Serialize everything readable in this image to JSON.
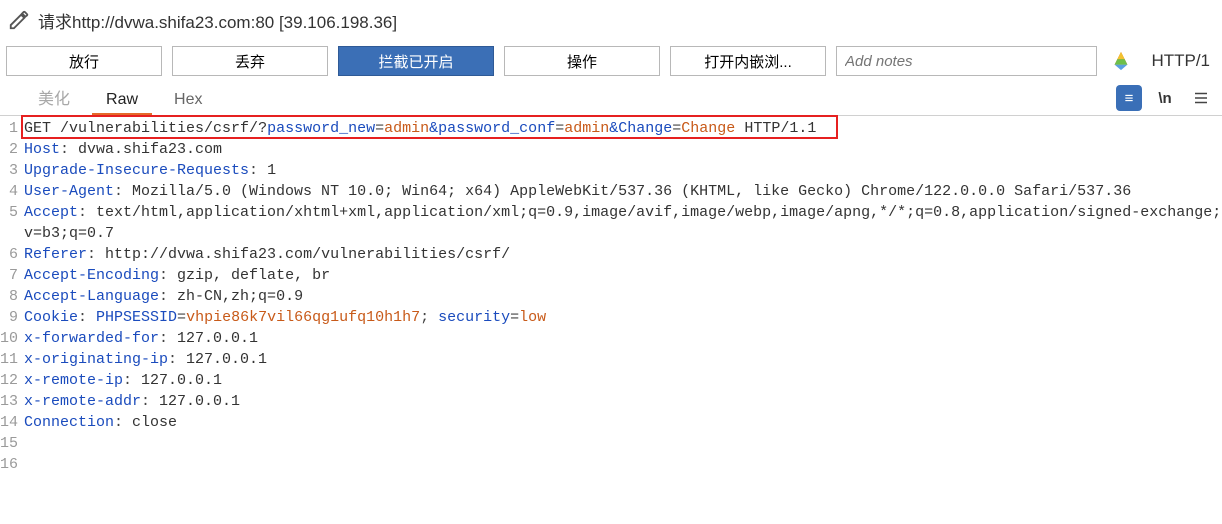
{
  "title": "请求http://dvwa.shifa23.com:80  [39.106.198.36]",
  "toolbar": {
    "forward": "放行",
    "drop": "丢弃",
    "intercept": "拦截已开启",
    "action": "操作",
    "open_browser": "打开内嵌浏...",
    "notes_placeholder": "Add notes",
    "protocol": "HTTP/1"
  },
  "tabs": {
    "beautify": "美化",
    "raw": "Raw",
    "hex": "Hex"
  },
  "http": {
    "method": "GET",
    "path": "/vulnerabilities/csrf/",
    "qmark": "?",
    "p1k": "password_new",
    "p1v": "admin",
    "amp": "&",
    "p2k": "password_conf",
    "p2v": "admin",
    "p3k": "Change",
    "p3v": "Change",
    "version": "HTTP/1.1",
    "host_k": "Host",
    "host_v": "dvwa.shifa23.com",
    "uir_k": "Upgrade-Insecure-Requests",
    "uir_v": "1",
    "ua_k": "User-Agent",
    "ua_v": "Mozilla/5.0 (Windows NT 10.0; Win64; x64) AppleWebKit/537.36 (KHTML, like Gecko) Chrome/122.0.0.0 Safari/537.36",
    "acc_k": "Accept",
    "acc_v": "text/html,application/xhtml+xml,application/xml;q=0.9,image/avif,image/webp,image/apng,*/*;q=0.8,application/signed-exchange;v=b3;q=0.7",
    "ref_k": "Referer",
    "ref_v": "http://dvwa.shifa23.com/vulnerabilities/csrf/",
    "ae_k": "Accept-Encoding",
    "ae_v": "gzip, deflate, br",
    "al_k": "Accept-Language",
    "al_v": "zh-CN,zh;q=0.9",
    "ck_k": "Cookie",
    "ck1k": "PHPSESSID",
    "ck1v": "vhpie86k7vil66qg1ufq10h1h7",
    "ck2k": "security",
    "ck2v": "low",
    "xff_k": "x-forwarded-for",
    "xff_v": "127.0.0.1",
    "xoi_k": "x-originating-ip",
    "xoi_v": "127.0.0.1",
    "xri_k": "x-remote-ip",
    "xri_v": "127.0.0.1",
    "xra_k": "x-remote-addr",
    "xra_v": "127.0.0.1",
    "conn_k": "Connection",
    "conn_v": "close"
  },
  "newline_label": "\\n",
  "selector_label": "≡"
}
